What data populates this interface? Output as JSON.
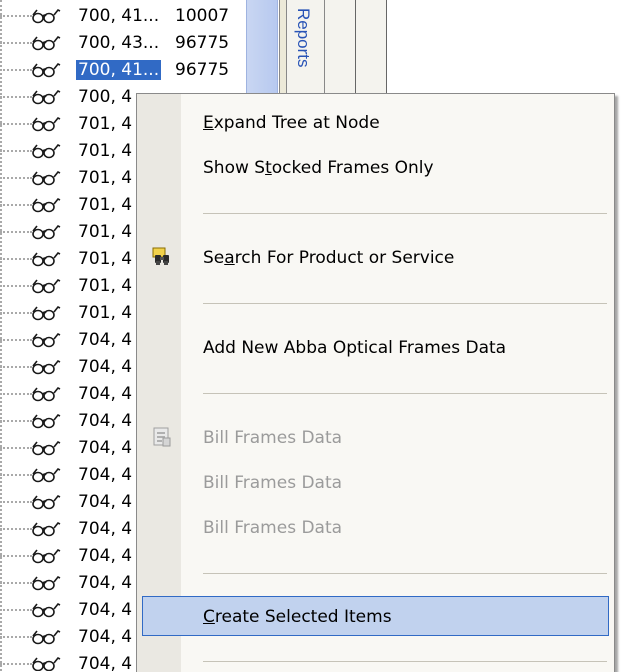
{
  "tree": {
    "rows": [
      {
        "name": "700, 41...",
        "value": "10007"
      },
      {
        "name": "700, 43...",
        "value": "96775"
      },
      {
        "name": "700, 41...",
        "value": "96775",
        "selected": true
      },
      {
        "name": "700, 4",
        "value": ""
      },
      {
        "name": "701, 4",
        "value": ""
      },
      {
        "name": "701, 4",
        "value": ""
      },
      {
        "name": "701, 4",
        "value": ""
      },
      {
        "name": "701, 4",
        "value": ""
      },
      {
        "name": "701, 4",
        "value": ""
      },
      {
        "name": "701, 4",
        "value": ""
      },
      {
        "name": "701, 4",
        "value": ""
      },
      {
        "name": "701, 4",
        "value": ""
      },
      {
        "name": "704, 4",
        "value": ""
      },
      {
        "name": "704, 4",
        "value": ""
      },
      {
        "name": "704, 4",
        "value": ""
      },
      {
        "name": "704, 4",
        "value": ""
      },
      {
        "name": "704, 4",
        "value": ""
      },
      {
        "name": "704, 4",
        "value": ""
      },
      {
        "name": "704, 4",
        "value": ""
      },
      {
        "name": "704, 4",
        "value": ""
      },
      {
        "name": "704, 4",
        "value": ""
      },
      {
        "name": "704, 4",
        "value": ""
      },
      {
        "name": "704, 4",
        "value": ""
      },
      {
        "name": "704, 4",
        "value": ""
      },
      {
        "name": "704, 4",
        "value": ""
      }
    ],
    "row_icon": "glasses-icon"
  },
  "side_tab": {
    "label": "Reports"
  },
  "context_menu": {
    "items": [
      {
        "type": "item",
        "label": "Expand Tree at Node",
        "mnemonic": "E",
        "enabled": true
      },
      {
        "type": "item",
        "label": "Show Stocked Frames Only",
        "mnemonic": "t",
        "enabled": true
      },
      {
        "type": "separator"
      },
      {
        "type": "item",
        "label": "Search For Product or Service",
        "mnemonic": "a",
        "enabled": true,
        "icon": "binoculars-icon"
      },
      {
        "type": "separator"
      },
      {
        "type": "item",
        "label": "Add New Abba Optical Frames Data",
        "enabled": true
      },
      {
        "type": "separator"
      },
      {
        "type": "item",
        "label": "Bill Frames Data",
        "enabled": false,
        "icon": "bill-icon"
      },
      {
        "type": "item",
        "label": "Bill Frames Data",
        "enabled": false
      },
      {
        "type": "item",
        "label": "Bill Frames Data",
        "enabled": false
      },
      {
        "type": "separator"
      },
      {
        "type": "item",
        "label": "Create Selected Items",
        "mnemonic": "C",
        "enabled": true,
        "highlighted": true
      },
      {
        "type": "separator"
      }
    ]
  },
  "colors": {
    "selection": "#316ac5",
    "menu_highlight": "#c1d2ee",
    "disabled_text": "#9b9b9b",
    "tab_text": "#2853b6"
  }
}
